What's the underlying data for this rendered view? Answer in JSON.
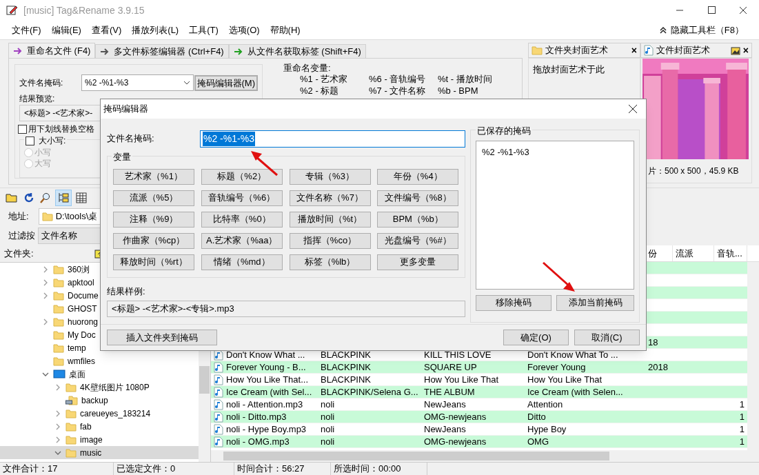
{
  "window": {
    "title": "[music] Tag&Rename 3.9.15"
  },
  "menu": [
    "文件(F)",
    "编辑(E)",
    "查看(V)",
    "播放列表(L)",
    "工具(T)",
    "选项(O)",
    "帮助(H)"
  ],
  "hide_toolbar": "隐藏工具栏（F8）",
  "tabs": [
    {
      "label": "重命名文件 (F4)",
      "selected": true
    },
    {
      "label": "多文件标签编辑器 (Ctrl+F4)",
      "selected": false
    },
    {
      "label": "从文件名获取标签 (Shift+F4)",
      "selected": false
    }
  ],
  "rename": {
    "mask_label": "文件名掩码:",
    "mask_value": "%2 -%1-%3",
    "mask_editor_button": "掩码编辑器(M)",
    "preview_label": "结果预览:",
    "preview_value": "<标题> -<艺术家>-",
    "underscore": {
      "label": "用下划线替换空格",
      "checked": false
    },
    "case": {
      "label": "大小写:",
      "checked": false,
      "options": [
        {
          "label": "小写",
          "selected": false,
          "disabled": true
        },
        {
          "label": "大写",
          "selected": false,
          "disabled": true
        }
      ]
    },
    "variables_title": "重命名变量:",
    "variables": [
      [
        "%1 - 艺术家",
        "%6 - 音轨编号",
        "%t - 播放时间"
      ],
      [
        "%2 - 标题",
        "%7 - 文件名称",
        "%b - BPM"
      ]
    ]
  },
  "cover": {
    "folder_tab": "文件夹封面艺术",
    "folder_close": "×",
    "folder_hint": "拖放封面艺术于此",
    "file_tab": "文件封面艺术",
    "file_close": "×",
    "image_info": "片：500 x 500，45.9 KB"
  },
  "toolbar": {
    "folder_view_pressed": true
  },
  "address": {
    "label": "地址:",
    "value": "D:\\tools\\桌"
  },
  "filter": {
    "label": "过滤按",
    "value": "文件名称"
  },
  "folders": {
    "title": "文件夹:",
    "tree": [
      {
        "label": "360浏",
        "kind": "folder",
        "expandable": true,
        "expanded": false,
        "selected": false
      },
      {
        "label": "apktool",
        "kind": "folder",
        "expandable": true,
        "expanded": false,
        "selected": false
      },
      {
        "label": "Docume",
        "kind": "folder",
        "expandable": true,
        "expanded": false,
        "selected": false
      },
      {
        "label": "GHOST",
        "kind": "folder",
        "expandable": false,
        "selected": false
      },
      {
        "label": "huorong",
        "kind": "folder",
        "expandable": true,
        "expanded": false,
        "selected": false
      },
      {
        "label": "My Doc",
        "kind": "folder",
        "expandable": false,
        "selected": false
      },
      {
        "label": "temp",
        "kind": "folder",
        "expandable": false,
        "selected": false
      },
      {
        "label": "wmfiles",
        "kind": "folder",
        "expandable": false,
        "selected": false
      },
      {
        "label": "桌面",
        "kind": "desktop",
        "expandable": true,
        "expanded": true,
        "selected": false,
        "children": [
          {
            "label": "4K壁纸图片 1080P",
            "kind": "folder",
            "expandable": true,
            "expanded": false,
            "selected": false
          },
          {
            "label": "backup",
            "kind": "shared",
            "expandable": false,
            "selected": false
          },
          {
            "label": "careueyes_183214",
            "kind": "folder",
            "expandable": true,
            "expanded": false,
            "selected": false
          },
          {
            "label": "fab",
            "kind": "folder",
            "expandable": true,
            "expanded": false,
            "selected": false
          },
          {
            "label": "image",
            "kind": "folder",
            "expandable": true,
            "expanded": false,
            "selected": false
          },
          {
            "label": "music",
            "kind": "folder",
            "expandable": true,
            "expanded": true,
            "selected": true
          }
        ]
      }
    ]
  },
  "table": {
    "columns": [
      "份",
      "流派",
      "音轨..."
    ],
    "rows": [
      {
        "highlighted": true
      },
      {
        "highlighted": false
      },
      {
        "highlighted": true
      },
      {
        "highlighted": false
      },
      {
        "highlighted": true
      },
      {
        "highlighted": false
      },
      {
        "highlighted": true,
        "year": "18"
      },
      {
        "highlighted": false,
        "name": "Don't Know What ...",
        "artist": "BLACKPINK",
        "album": "KILL THIS LOVE",
        "title": "Don't Know What To ..."
      },
      {
        "highlighted": true,
        "name": "Forever Young - B...",
        "artist": "BLACKPINK",
        "album": "SQUARE UP",
        "title": "Forever Young",
        "year": "2018"
      },
      {
        "highlighted": false,
        "name": "How You Like That...",
        "artist": "BLACKPINK",
        "album": "How You Like That",
        "title": "How You Like That"
      },
      {
        "highlighted": true,
        "name": "Ice Cream (with Sel...",
        "artist": "BLACKPINK/Selena G...",
        "album": "THE ALBUM",
        "title": "Ice Cream (with Selen..."
      },
      {
        "highlighted": false,
        "name": "noli - Attention.mp3",
        "artist": "noli",
        "album": "NewJeans",
        "title": "Attention",
        "track": "1"
      },
      {
        "highlighted": true,
        "name": "noli - Ditto.mp3",
        "artist": "noli",
        "album": "OMG-newjeans",
        "title": "Ditto",
        "track": "1"
      },
      {
        "highlighted": false,
        "name": "noli - Hype Boy.mp3",
        "artist": "noli",
        "album": "NewJeans",
        "title": "Hype Boy",
        "track": "1"
      },
      {
        "highlighted": true,
        "name": "noli - OMG.mp3",
        "artist": "noli",
        "album": "OMG-newjeans",
        "title": "OMG",
        "track": "1"
      }
    ]
  },
  "status_bar": [
    "文件合计：17",
    "已选定文件：0",
    "时间合计：56:27",
    "所选时间：00:00"
  ],
  "dialog": {
    "title": "掩码编辑器",
    "mask_label": "文件名掩码:",
    "mask_value": "%2 -%1-%3",
    "variables_title": "变量",
    "variables": [
      "艺术家（%1）",
      "标题（%2）",
      "专辑（%3）",
      "年份（%4）",
      "流派（%5）",
      "音轨编号（%6）",
      "文件名称（%7）",
      "文件编号（%8）",
      "注释（%9）",
      "比特率（%0）",
      "播放时间（%t）",
      "BPM（%b）",
      "作曲家（%cp）",
      "A.艺术家（%aa）",
      "指挥（%co）",
      "光盘编号（%#）",
      "释放时间（%rt）",
      "情绪（%md）",
      "标签（%lb）",
      "更多变量"
    ],
    "sample_label": "结果样例:",
    "sample_value": "<标题> -<艺术家>-<专辑>.mp3",
    "saved_title": "已保存的掩码",
    "saved": [
      "%2 -%1-%3"
    ],
    "remove_button": "移除掩码",
    "add_button": "添加当前掩码",
    "insert_button": "插入文件夹到掩码",
    "ok_button": "确定(O)",
    "cancel_button": "取消(C)"
  }
}
